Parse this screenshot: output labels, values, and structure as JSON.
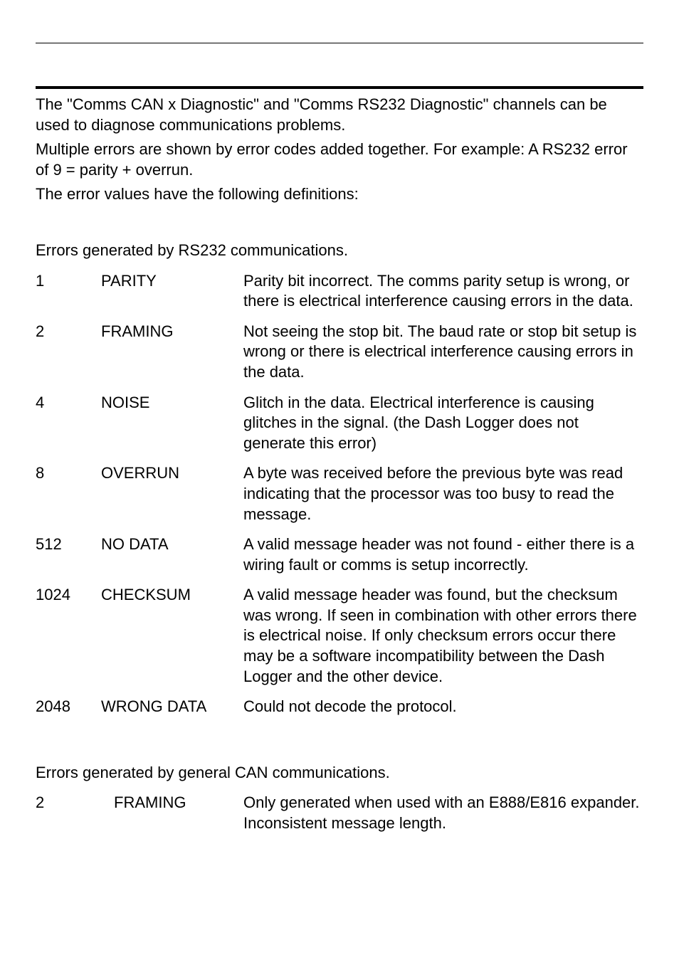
{
  "intro": {
    "p1": "The \"Comms CAN x Diagnostic\" and \"Comms RS232 Diagnostic\" channels can be used to diagnose communications problems.",
    "p2": "Multiple errors are shown by error codes added together. For example: A RS232 error of 9 = parity + overrun.",
    "p3": "The error values have the following definitions:"
  },
  "rs232": {
    "note": "Errors generated by RS232 communications.",
    "rows": [
      {
        "code": "1",
        "name": "PARITY",
        "desc": "Parity bit incorrect. The comms parity setup is wrong, or there is electrical interference causing errors in the data."
      },
      {
        "code": "2",
        "name": "FRAMING",
        "desc": "Not seeing the stop bit. The baud rate or stop bit setup is wrong or there is electrical interference causing errors in the data."
      },
      {
        "code": "4",
        "name": "NOISE",
        "desc": "Glitch in the data. Electrical interference is causing glitches in the signal. (the Dash Logger does not generate this error)"
      },
      {
        "code": "8",
        "name": "OVERRUN",
        "desc": "A byte was received before the previous byte was read indicating that the processor was too busy to read the message."
      },
      {
        "code": "512",
        "name": "NO DATA",
        "desc": "A valid message header was not found - either there is a wiring fault or comms is setup incorrectly."
      },
      {
        "code": "1024",
        "name": "CHECKSUM",
        "desc": "A valid message header was found, but the checksum was wrong. If seen in combination with other errors there is electrical noise. If only checksum errors occur there may be a software incompatibility between the Dash Logger and the other device."
      },
      {
        "code": "2048",
        "name": "WRONG DATA",
        "desc": "Could not decode the protocol."
      }
    ]
  },
  "can": {
    "note": "Errors generated by general CAN communications.",
    "rows": [
      {
        "code": "2",
        "name": "FRAMING",
        "desc": "Only generated when used with an E888/E816 expander. Inconsistent message length."
      }
    ]
  }
}
